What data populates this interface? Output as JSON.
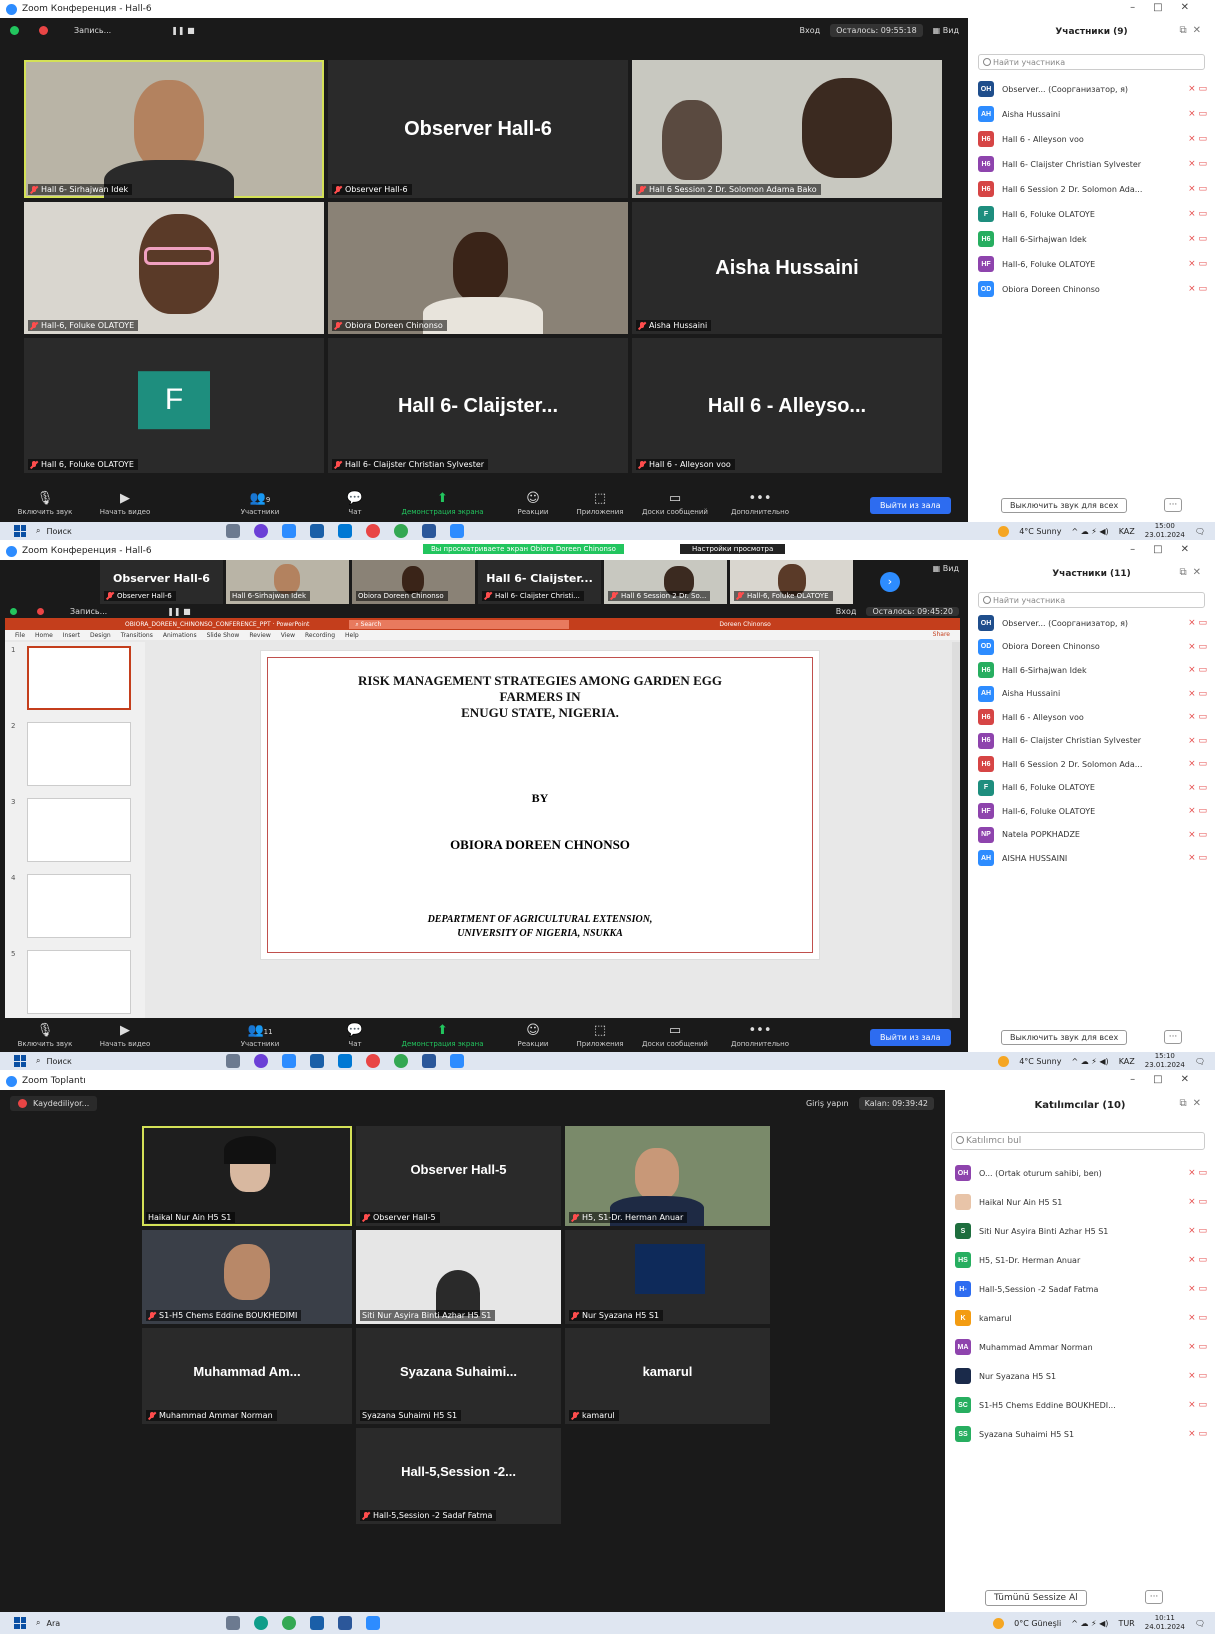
{
  "shot1": {
    "window_title": "Zoom Конференция - Hall-6",
    "recording_label": "Запись...",
    "enter_label": "Вход",
    "time_left": "Осталось: 09:55:18",
    "view_label": "Вид",
    "tiles": [
      {
        "label": "Hall 6- Sirhajwan Idek",
        "big": ""
      },
      {
        "label": "Observer Hall-6",
        "big": "Observer Hall-6"
      },
      {
        "label": "Hall 6 Session 2 Dr. Solomon Adama Bako",
        "big": ""
      },
      {
        "label": "Hall-6, Foluke OLATOYE",
        "big": ""
      },
      {
        "label": "Obiora Doreen Chinonso",
        "big": ""
      },
      {
        "label": "Aisha Hussaini",
        "big": "Aisha Hussaini"
      },
      {
        "label": "Hall 6, Foluke OLATOYE",
        "big": ""
      },
      {
        "label": "Hall 6- Claijster Christian Sylvester",
        "big": "Hall 6- Claijster..."
      },
      {
        "label": "Hall 6 - Alleyson voo",
        "big": "Hall 6 - Alleyso..."
      }
    ],
    "avatar_letter": "F",
    "toolbar": {
      "unmute": "Включить звук",
      "start_video": "Начать видео",
      "participants": "Участники",
      "participants_count": "9",
      "chat": "Чат",
      "share": "Демонстрация экрана",
      "reactions": "Реакции",
      "apps": "Приложения",
      "whiteboards": "Доски сообщений",
      "more": "Дополнительно",
      "leave": "Выйти из зала"
    },
    "panel": {
      "title": "Участники (9)",
      "search_placeholder": "Найти участника",
      "mute_all": "Выключить звук для всех",
      "participants": [
        {
          "initials": "OH",
          "name": "Observer... (Соорганизатор, я)",
          "color": "#1f4e8c"
        },
        {
          "initials": "AH",
          "name": "Aisha Hussaini",
          "color": "#2d8cff"
        },
        {
          "initials": "H6",
          "name": "Hall 6 - Alleyson voo",
          "color": "#d64545"
        },
        {
          "initials": "H6",
          "name": "Hall 6- Claijster Christian Sylvester",
          "color": "#8e44ad"
        },
        {
          "initials": "H6",
          "name": "Hall 6 Session 2 Dr. Solomon Ada...",
          "color": "#d64545"
        },
        {
          "initials": "F",
          "name": "Hall 6, Foluke OLATOYE",
          "color": "#1e8e7e"
        },
        {
          "initials": "H6",
          "name": "Hall 6-Sirhajwan Idek",
          "color": "#27ae60"
        },
        {
          "initials": "HF",
          "name": "Hall-6, Foluke OLATOYE",
          "color": "#8e44ad"
        },
        {
          "initials": "OD",
          "name": "Obiora Doreen Chinonso",
          "color": "#2d8cff"
        }
      ]
    },
    "taskbar": {
      "search": "Поиск",
      "weather": "4°C Sunny",
      "lang": "KAZ",
      "time": "15:00",
      "date": "23.01.2024"
    }
  },
  "shot2": {
    "window_title": "Zoom Конференция - Hall-6",
    "viewing_banner": "Вы просматриваете экран Obiora Doreen Chinonso",
    "view_options": "Настройки просмотра",
    "strip": [
      {
        "big": "Observer Hall-6",
        "label": "Observer Hall-6"
      },
      {
        "big": "",
        "label": "Hall 6-Sirhajwan Idek"
      },
      {
        "big": "",
        "label": "Obiora Doreen Chinonso"
      },
      {
        "big": "Hall 6- Claijster...",
        "label": "Hall 6- Claijster Christi..."
      },
      {
        "big": "",
        "label": "Hall 6 Session 2 Dr. So..."
      },
      {
        "big": "",
        "label": "Hall-6, Foluke OLATOYE"
      }
    ],
    "recording_label": "Запись...",
    "enter_label": "Вход",
    "time_left": "Осталось: 09:45:20",
    "view_label": "Вид",
    "ppt": {
      "file_title": "OBIORA_DOREEN_CHINONSO_CONFERENCE_PPT · PowerPoint",
      "search": "Search",
      "user": "Doreen Chinonso",
      "share": "Share",
      "menu": [
        "File",
        "Home",
        "Insert",
        "Design",
        "Transitions",
        "Animations",
        "Slide Show",
        "Review",
        "View",
        "Recording",
        "Help"
      ],
      "slide_lines": [
        "RISK MANAGEMENT STRATEGIES AMONG GARDEN EGG",
        "FARMERS IN",
        "ENUGU STATE, NIGERIA."
      ],
      "by": "BY",
      "author": "OBIORA DOREEN CHNONSO",
      "dept1": "DEPARTMENT OF AGRICULTURAL EXTENSION,",
      "dept2": "UNIVERSITY OF NIGERIA, NSUKKA",
      "thumb_numbers": [
        "1",
        "2",
        "3",
        "4",
        "5"
      ]
    },
    "toolbar": {
      "unmute": "Включить звук",
      "start_video": "Начать видео",
      "participants": "Участники",
      "participants_count": "11",
      "chat": "Чат",
      "share": "Демонстрация экрана",
      "reactions": "Реакции",
      "apps": "Приложения",
      "whiteboards": "Доски сообщений",
      "more": "Дополнительно",
      "leave": "Выйти из зала"
    },
    "panel": {
      "title": "Участники (11)",
      "search_placeholder": "Найти участника",
      "mute_all": "Выключить звук для всех",
      "participants": [
        {
          "initials": "OH",
          "name": "Observer... (Соорганизатор, я)",
          "color": "#1f4e8c"
        },
        {
          "initials": "OD",
          "name": "Obiora Doreen Chinonso",
          "color": "#2d8cff"
        },
        {
          "initials": "H6",
          "name": "Hall 6-Sirhajwan Idek",
          "color": "#27ae60"
        },
        {
          "initials": "AH",
          "name": "Aisha Hussaini",
          "color": "#2d8cff"
        },
        {
          "initials": "H6",
          "name": "Hall 6 - Alleyson voo",
          "color": "#d64545"
        },
        {
          "initials": "H6",
          "name": "Hall 6- Claijster Christian Sylvester",
          "color": "#8e44ad"
        },
        {
          "initials": "H6",
          "name": "Hall 6 Session 2 Dr. Solomon Ada...",
          "color": "#d64545"
        },
        {
          "initials": "F",
          "name": "Hall 6, Foluke OLATOYE",
          "color": "#1e8e7e"
        },
        {
          "initials": "HF",
          "name": "Hall-6, Foluke OLATOYE",
          "color": "#8e44ad"
        },
        {
          "initials": "NP",
          "name": "Natela POPKHADZE",
          "color": "#8e44ad"
        },
        {
          "initials": "AH",
          "name": "AISHA HUSSAINI",
          "color": "#2d8cff"
        }
      ]
    },
    "taskbar": {
      "search": "Поиск",
      "weather": "4°C Sunny",
      "lang": "KAZ",
      "time": "15:10",
      "date": "23.01.2024"
    }
  },
  "shot3": {
    "window_title": "Zoom Toplantı",
    "recording_label": "Kaydediliyor...",
    "signin": "Giriş yapın",
    "time_left": "Kalan: 09:39:42",
    "tiles": [
      {
        "label": "Haikal Nur Ain H5 S1",
        "big": ""
      },
      {
        "label": "Observer Hall-5",
        "big": "Observer Hall-5"
      },
      {
        "label": "H5, S1-Dr. Herman Anuar",
        "big": ""
      },
      {
        "label": "S1-H5 Chems Eddine BOUKHEDIMI",
        "big": ""
      },
      {
        "label": "Siti Nur Asyira Binti Azhar H5 S1",
        "big": ""
      },
      {
        "label": "Nur Syazana H5 S1",
        "big": ""
      },
      {
        "label": "Muhammad Ammar Norman",
        "big": "Muhammad Am..."
      },
      {
        "label": "Syazana Suhaimi H5 S1",
        "big": "Syazana Suhaimi..."
      },
      {
        "label": "kamarul",
        "big": "kamarul"
      },
      {
        "label": "Hall-5,Session -2 Sadaf Fatma",
        "big": "Hall-5,Session -2..."
      }
    ],
    "panel": {
      "title": "Katılımcılar (10)",
      "search_placeholder": "Katılımcı bul",
      "mute_all": "Tümünü Sessize Al",
      "participants": [
        {
          "initials": "OH",
          "name": "O... (Ortak oturum sahibi, ben)",
          "color": "#8e44ad"
        },
        {
          "initials": "",
          "name": "Haikal Nur Ain H5 S1",
          "color": "#e8c4a8"
        },
        {
          "initials": "S",
          "name": "Siti Nur Asyira Binti Azhar H5 S1",
          "color": "#1e6e3e"
        },
        {
          "initials": "HS",
          "name": "H5, S1-Dr. Herman Anuar",
          "color": "#27ae60"
        },
        {
          "initials": "H-",
          "name": "Hall-5,Session -2 Sadaf Fatma",
          "color": "#2d6cf0"
        },
        {
          "initials": "K",
          "name": "kamarul",
          "color": "#f39c12"
        },
        {
          "initials": "MA",
          "name": "Muhammad Ammar Norman",
          "color": "#8e44ad"
        },
        {
          "initials": "",
          "name": "Nur Syazana H5 S1",
          "color": "#1a2a4a"
        },
        {
          "initials": "SC",
          "name": "S1-H5 Chems Eddine BOUKHEDI...",
          "color": "#27ae60"
        },
        {
          "initials": "SS",
          "name": "Syazana Suhaimi H5 S1",
          "color": "#27ae60"
        }
      ]
    },
    "taskbar": {
      "search": "Ara",
      "weather": "0°C Güneşli",
      "lang": "TUR",
      "time": "10:11",
      "date": "24.01.2024"
    }
  }
}
